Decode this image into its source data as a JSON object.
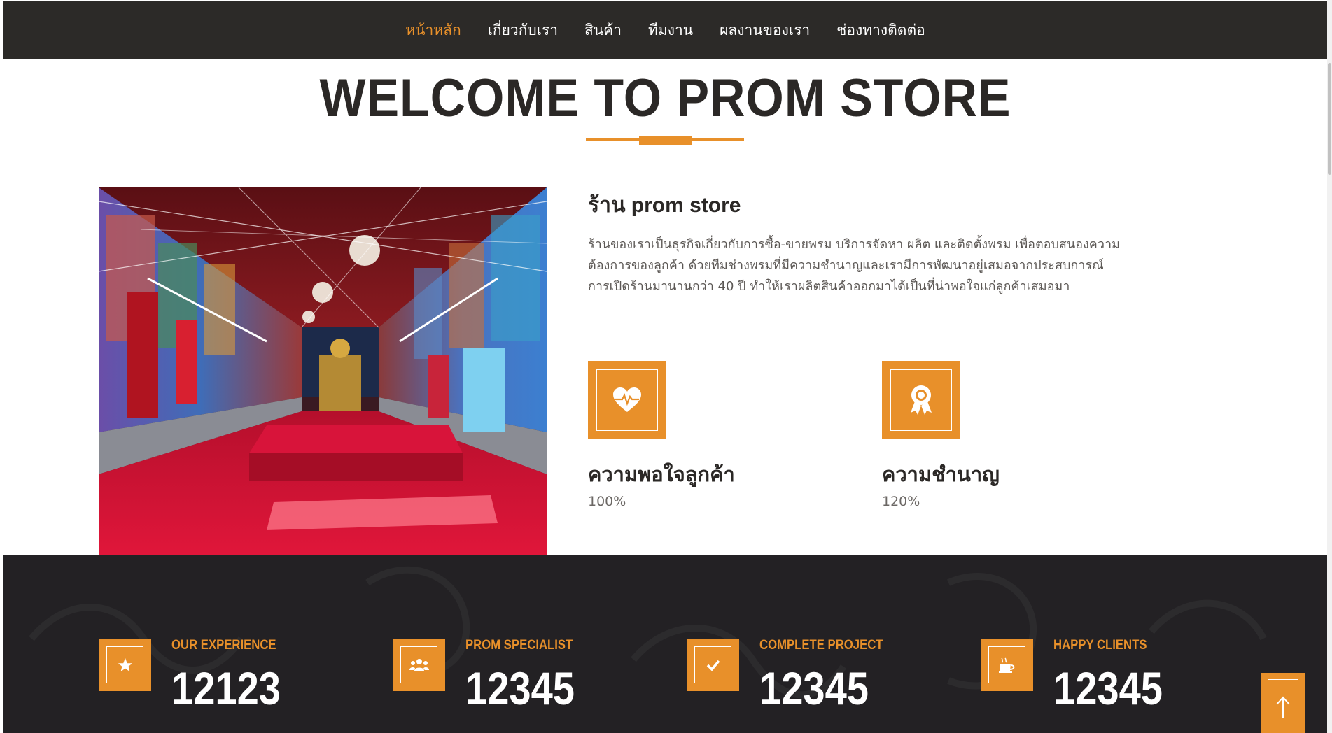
{
  "nav": {
    "items": [
      {
        "label": "หน้าหลัก",
        "active": true
      },
      {
        "label": "เกี่ยวกับเรา",
        "active": false
      },
      {
        "label": "สินค้า",
        "active": false
      },
      {
        "label": "ทีมงาน",
        "active": false
      },
      {
        "label": "ผลงานของเรา",
        "active": false
      },
      {
        "label": "ช่องทางติดต่อ",
        "active": false
      }
    ]
  },
  "hero": {
    "title": "WELCOME TO PROM STORE"
  },
  "about": {
    "title": "ร้าน prom store",
    "text": "ร้านของเราเป็นธุรกิจเกี่ยวกับการซื้อ-ขายพรม บริการจัดหา ผลิต และติดตั้งพรม เพื่อตอบสนองความต้องการของลูกค้า ด้วยทีมช่างพรมที่มีความชำนาญและเรามีการพัฒนาอยู่เสมอจากประสบการณ์การเปิดร้านมานานกว่า 40 ปี ทำให้เราผลิตสินค้าออกมาได้เป็นที่น่าพอใจแก่ลูกค้าเสมอมา",
    "features": [
      {
        "icon": "heart-pulse-icon",
        "title": "ความพอใจลูกค้า",
        "value": "100%"
      },
      {
        "icon": "award-ribbon-icon",
        "title": "ความชำนาญ",
        "value": "120%"
      }
    ]
  },
  "stats": [
    {
      "icon": "star-icon",
      "label": "OUR EXPERIENCE",
      "value": "12123"
    },
    {
      "icon": "users-icon",
      "label": "PROM SPECIALIST",
      "value": "12345"
    },
    {
      "icon": "check-icon",
      "label": "COMPLETE PROJECT",
      "value": "12345"
    },
    {
      "icon": "coffee-cup-icon",
      "label": "HAPPY CLIENTS",
      "value": "12345"
    }
  ],
  "colors": {
    "accent": "#e8902a",
    "dark": "#2c2a28",
    "stats_bg": "#232124"
  }
}
